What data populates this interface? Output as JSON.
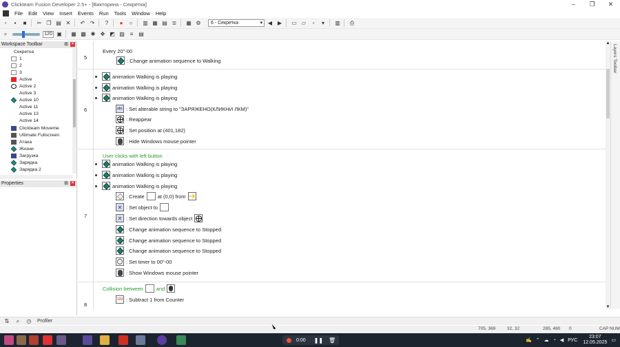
{
  "titlebar": {
    "title": "Clickteam Fusion Developer 2.5+ - [Викторина - Секретка]",
    "min": "–",
    "max": "❐",
    "close": "✕"
  },
  "menu": [
    "File",
    "Edit",
    "View",
    "Insert",
    "Events",
    "Run",
    "Tools",
    "Window",
    "Help"
  ],
  "toolbar": {
    "frame_select": "6 - Секретка",
    "zoom_value": "120"
  },
  "workspace": {
    "title": "Workspace Toolbar",
    "items": [
      {
        "label": "Секретка",
        "icon": "folder-icon",
        "root": true
      },
      {
        "label": "1",
        "icon": "text-object-icon"
      },
      {
        "label": "2",
        "icon": "blank-object-icon"
      },
      {
        "label": "3",
        "icon": "blank-object-icon"
      },
      {
        "label": "Active",
        "icon": "red-square-icon"
      },
      {
        "label": "Active 2",
        "icon": "crosshair-icon"
      },
      {
        "label": "Active 3",
        "icon": "none-icon"
      },
      {
        "label": "Active 10",
        "icon": "diamond-icon"
      },
      {
        "label": "Active 11",
        "icon": "dash-icon"
      },
      {
        "label": "Active 13",
        "icon": "dash-icon"
      },
      {
        "label": "Active 14",
        "icon": "dash-icon"
      },
      {
        "label": "Clickteam Moveme",
        "icon": "blue-object-icon"
      },
      {
        "label": "Ultimate Fullscreen",
        "icon": "fullscreen-icon"
      },
      {
        "label": "Атака",
        "icon": "counter-icon"
      },
      {
        "label": "Жизни",
        "icon": "diamond-icon"
      },
      {
        "label": "Загрузка",
        "icon": "blue-object-icon"
      },
      {
        "label": "Зарядка",
        "icon": "diamond-icon"
      },
      {
        "label": "Зарядка 2",
        "icon": "diamond-icon"
      }
    ]
  },
  "properties": {
    "title": "Properties"
  },
  "editor": {
    "events": [
      {
        "num": "5"
      },
      {
        "num": "6"
      },
      {
        "num": "7"
      },
      {
        "num": "8"
      }
    ],
    "lines": {
      "e5_cond": "Every 20\"-00",
      "e5_act1": ": Change animation sequence to Walking",
      "e6_c1": "animation Walking is playing",
      "e6_c2": "animation Walking is playing",
      "e6_c3": "animation Walking is playing",
      "e6_a1": ": Set alterable string to \"ЗАРЯЖЕНО(КЛИКНИ ЛКМ)\"",
      "e6_a2": ": Reappear",
      "e6_a3": ": Set position at (401,182)",
      "e6_a4": ": Hide Windows mouse pointer",
      "e7_cond": "User clicks with left button",
      "e7_c1": "animation Walking is playing",
      "e7_c2": "animation Walking is playing",
      "e7_c3": "animation Walking is playing",
      "e7_a1a": ": Create",
      "e7_a1b": "at (0,0) from",
      "e7_a2": ": Set object to",
      "e7_a3": ": Set direction towards object",
      "e7_a4": ": Change animation sequence to Stopped",
      "e7_a5": ": Change animation sequence to Stopped",
      "e7_a6": ": Change animation sequence to Stopped",
      "e7_a7": ": Set timer to 00\"-00",
      "e7_a8": ": Show Windows mouse pointer",
      "e8_cond_a": "Collision between",
      "e8_cond_b": "and",
      "e8_a1": ": Subtract 1 from Counter"
    }
  },
  "layers": {
    "label": "Layers Toolbar"
  },
  "profiler": {
    "label": "Profiler"
  },
  "statusbar": {
    "coords1": "705, 369",
    "coords2": "32, 32",
    "coords3": "285, 480",
    "zero": "0",
    "caps": "CAP NUM"
  },
  "taskbar": {
    "rec_time": "0:00",
    "lang": "РУС",
    "time": "23:07",
    "date": "12.05.2025"
  }
}
